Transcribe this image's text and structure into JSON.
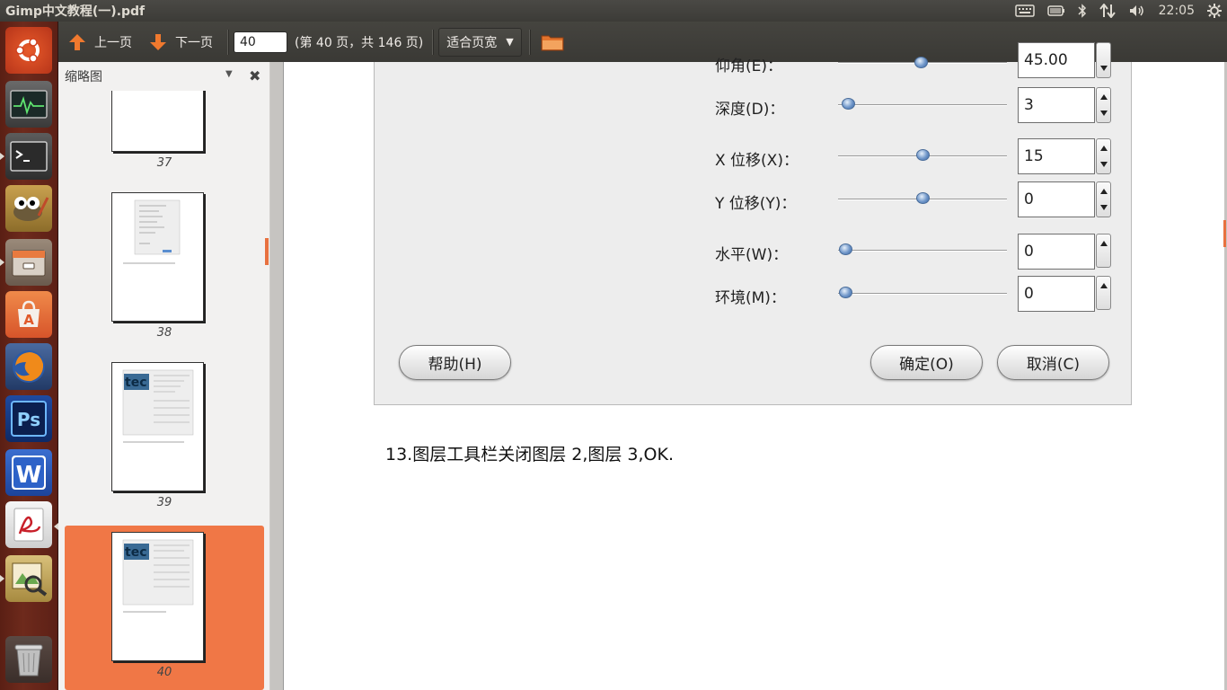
{
  "window": {
    "title": "Gimp中文教程(一).pdf"
  },
  "panel": {
    "clock": "22:05",
    "indicators": [
      "keyboard-icon",
      "battery-icon",
      "bluetooth-icon",
      "network-icon",
      "volume-icon",
      "power-gear-icon"
    ]
  },
  "launcher": {
    "items": [
      "ubuntu-dash-icon",
      "system-monitor-icon",
      "terminal-icon",
      "gimp-icon",
      "file-manager-icon",
      "software-center-icon",
      "firefox-icon",
      "photoshop-icon",
      "wps-writer-icon",
      "pdf-reader-icon",
      "image-viewer-icon",
      "trash-icon"
    ]
  },
  "toolbar": {
    "prev_label": "上一页",
    "next_label": "下一页",
    "page_value": "40",
    "page_of": "(第 40 页，共 146 页)",
    "zoom_label": "适合页宽"
  },
  "sidebar": {
    "title": "缩略图",
    "thumbnails": [
      {
        "page": "37"
      },
      {
        "page": "38"
      },
      {
        "page": "39"
      },
      {
        "page": "40",
        "selected": true
      }
    ]
  },
  "dialog": {
    "rows": [
      {
        "label": "仰角(E)：",
        "value": "45.00"
      },
      {
        "label": "深度(D)：",
        "value": "3",
        "level": 0.06
      },
      {
        "label": "X 位移(X)：",
        "value": "15",
        "level": 0.5
      },
      {
        "label": "Y 位移(Y)：",
        "value": "0",
        "level": 0.5
      },
      {
        "label": "水平(W)：",
        "value": "0",
        "level": 0.04
      },
      {
        "label": "环境(M)：",
        "value": "0",
        "level": 0.04
      }
    ],
    "help_button": "帮助(H)",
    "ok_button": "确定(O)",
    "cancel_button": "取消(C)"
  },
  "document": {
    "text": "13.图层工具栏关闭图层 2,图层 3,OK."
  },
  "colors": {
    "accent": "#f07746",
    "panel": "#3c3b37",
    "launcher": "#6e2a1c"
  }
}
